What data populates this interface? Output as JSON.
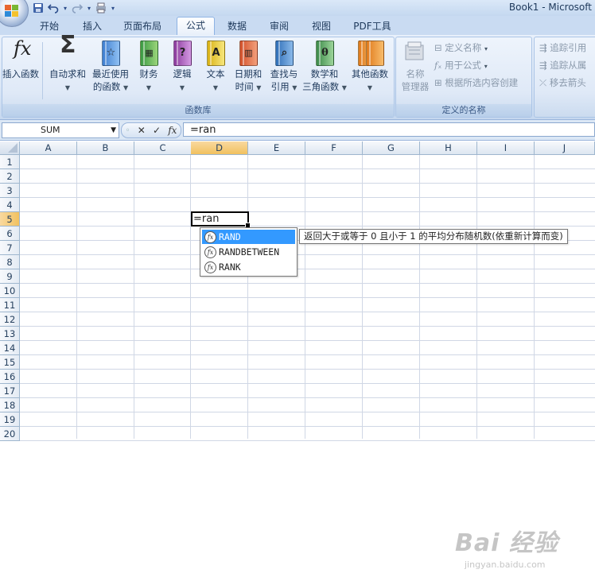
{
  "window": {
    "title": "Book1 - Microsoft"
  },
  "tabs": [
    "开始",
    "插入",
    "页面布局",
    "公式",
    "数据",
    "审阅",
    "视图",
    "PDF工具"
  ],
  "active_tab": "公式",
  "ribbon": {
    "function_library": {
      "label": "函数库",
      "insert_function": {
        "line1": "插入函数",
        "icon": "fx-icon"
      },
      "autosum": {
        "line1": "自动求和",
        "icon": "sigma-icon"
      },
      "recent": {
        "line1": "最近使用",
        "line2": "的函数",
        "icon": "star-book-icon"
      },
      "financial": {
        "line1": "财务",
        "icon": "finance-book-icon"
      },
      "logical": {
        "line1": "逻辑",
        "icon": "question-book-icon"
      },
      "text": {
        "line1": "文本",
        "icon": "text-book-icon"
      },
      "datetime": {
        "line1": "日期和",
        "line2": "时间",
        "icon": "calendar-book-icon"
      },
      "lookup": {
        "line1": "查找与",
        "line2": "引用",
        "icon": "magnifier-book-icon"
      },
      "math": {
        "line1": "数学和",
        "line2": "三角函数",
        "icon": "theta-book-icon"
      },
      "more": {
        "line1": "其他函数",
        "icon": "books-icon"
      }
    },
    "defined_names": {
      "label": "定义的名称",
      "name_manager": {
        "line1": "名称",
        "line2": "管理器"
      },
      "define_name": "定义名称",
      "use_in_formula": "用于公式",
      "create_from_selection": "根据所选内容创建"
    },
    "auditing": {
      "trace_precedents": "追踪引用",
      "trace_dependents": "追踪从属",
      "remove_arrows": "移去箭头"
    }
  },
  "formula_bar": {
    "name_box": "SUM",
    "cancel": "✕",
    "enter": "✓",
    "fx": "fx",
    "formula": "=ran"
  },
  "grid": {
    "columns": [
      "A",
      "B",
      "C",
      "D",
      "E",
      "F",
      "G",
      "H",
      "I",
      "J"
    ],
    "rows": [
      "1",
      "2",
      "3",
      "4",
      "5",
      "6",
      "7",
      "8",
      "9",
      "10",
      "11",
      "12",
      "13",
      "14",
      "15",
      "16",
      "17",
      "18",
      "19",
      "20"
    ],
    "active_column": "D",
    "active_row": "5",
    "active_cell_value": "=ran"
  },
  "autocomplete": {
    "items": [
      "RAND",
      "RANDBETWEEN",
      "RANK"
    ],
    "selected": "RAND",
    "tooltip": "返回大于或等于 0 且小于 1 的平均分布随机数(依重新计算而变)"
  },
  "watermark": {
    "brand": "Bai 经验",
    "url": "jingyan.baidu.com"
  },
  "colors": {
    "accent": "#3399ff",
    "header_selected": "#f1c15f",
    "ribbon": "#dae6f6"
  }
}
